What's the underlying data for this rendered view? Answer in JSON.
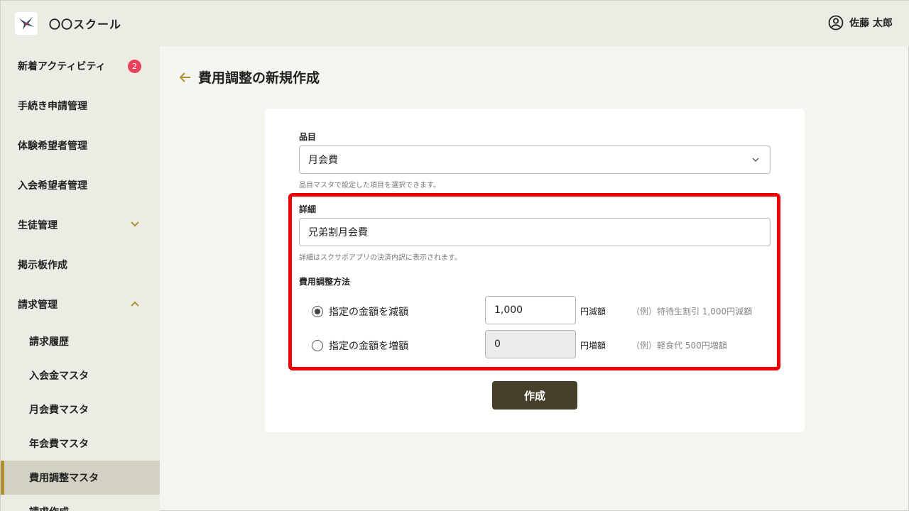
{
  "header": {
    "school_name": "〇〇スクール",
    "user_name": "佐藤 太郎"
  },
  "sidebar": {
    "items": [
      {
        "label": "新着アクティビティ",
        "badge": "2"
      },
      {
        "label": "手続き申請管理"
      },
      {
        "label": "体験希望者管理"
      },
      {
        "label": "入会希望者管理"
      },
      {
        "label": "生徒管理"
      },
      {
        "label": "掲示板作成"
      },
      {
        "label": "請求管理"
      }
    ],
    "sub_items": [
      {
        "label": "請求履歴"
      },
      {
        "label": "入会金マスタ"
      },
      {
        "label": "月会費マスタ"
      },
      {
        "label": "年会費マスタ"
      },
      {
        "label": "費用調整マスタ",
        "active": true
      },
      {
        "label": "請求作成"
      }
    ]
  },
  "main": {
    "title": "費用調整の新規作成"
  },
  "form": {
    "item_label": "品目",
    "item_value": "月会費",
    "item_help": "品目マスタで設定した項目を選択できます。",
    "detail_label": "詳細",
    "detail_value": "兄弟割月会費",
    "detail_help": "詳細はスクサポアプリの決済内訳に表示されます。",
    "method_label": "費用調整方法",
    "options": [
      {
        "label": "指定の金額を減額",
        "selected": true,
        "amount": "1,000",
        "unit": "円減額",
        "example": "（例）特待生割引 1,000円減額"
      },
      {
        "label": "指定の金額を増額",
        "selected": false,
        "amount": "0",
        "unit": "円増額",
        "example": "（例）軽食代 500円増額"
      }
    ],
    "submit_label": "作成"
  },
  "colors": {
    "accent": "#b09032",
    "button": "#46402a",
    "badge": "#e8415a",
    "highlight": "#ee0000"
  }
}
